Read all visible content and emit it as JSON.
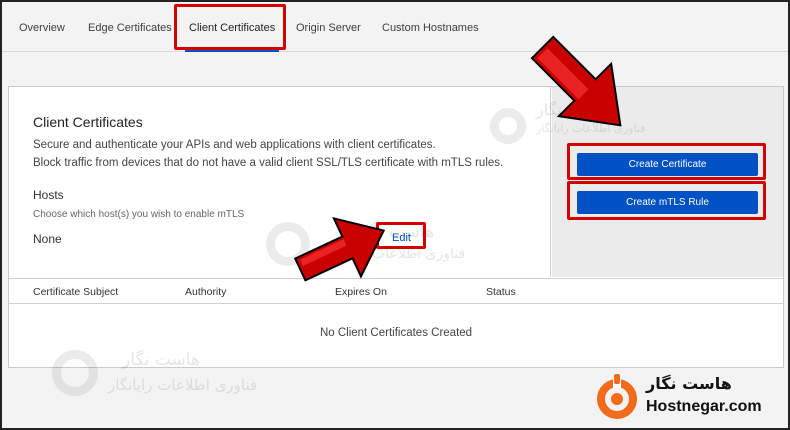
{
  "tabs": [
    {
      "label": "Overview"
    },
    {
      "label": "Edge Certificates"
    },
    {
      "label": "Client Certificates",
      "active": true
    },
    {
      "label": "Origin Server"
    },
    {
      "label": "Custom Hostnames"
    }
  ],
  "card": {
    "title": "Client Certificates",
    "description_line1": "Secure and authenticate your APIs and web applications with client certificates.",
    "description_line2": "Block traffic from devices that do not have a valid client SSL/TLS certificate with mTLS rules.",
    "hosts_title": "Hosts",
    "hosts_help": "Choose which host(s) you wish to enable mTLS",
    "hosts_value": "None",
    "edit_label": "Edit",
    "create_certificate_label": "Create Certificate",
    "create_mtls_rule_label": "Create mTLS Rule"
  },
  "table": {
    "columns": [
      "Certificate Subject",
      "Authority",
      "Expires On",
      "Status"
    ],
    "empty_message": "No Client Certificates Created"
  },
  "branding": {
    "name_fa": "هاست نگار",
    "name_en": "Hostnegar.com",
    "watermark_name": "هاست نگار",
    "watermark_sub": "فناوری اطلاعات رایانگار",
    "accent_color": "#f26a1b",
    "primary_button_color": "#0051c3",
    "annotation_color": "#d40000"
  }
}
